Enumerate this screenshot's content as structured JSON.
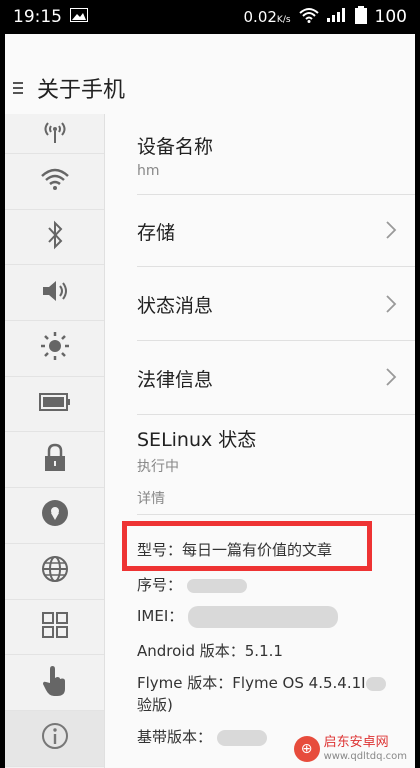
{
  "status_bar": {
    "time": "19:15",
    "network_speed": "0.02",
    "network_unit": "K/s",
    "battery": "100"
  },
  "header": {
    "title": "关于手机"
  },
  "sidebar": {
    "items": [
      {
        "icon": "antenna-icon"
      },
      {
        "icon": "wifi-icon"
      },
      {
        "icon": "bluetooth-icon"
      },
      {
        "icon": "volume-icon"
      },
      {
        "icon": "brightness-icon"
      },
      {
        "icon": "battery-icon"
      },
      {
        "icon": "lock-icon"
      },
      {
        "icon": "location-icon"
      },
      {
        "icon": "globe-icon"
      },
      {
        "icon": "apps-grid-icon"
      },
      {
        "icon": "hand-icon"
      },
      {
        "icon": "info-icon"
      }
    ]
  },
  "main": {
    "device_name_label": "设备名称",
    "device_name_value": "hm",
    "storage_label": "存储",
    "status_label": "状态消息",
    "legal_label": "法律信息",
    "selinux_label": "SELinux 状态",
    "selinux_value": "执行中",
    "details_header": "详情",
    "model_label": "型号：",
    "model_value": "每日一篇有价值的文章",
    "serial_label": "序号：",
    "imei_label": "IMEI：",
    "android_label": "Android 版本：",
    "android_value": "5.1.1",
    "flyme_label": "Flyme 版本：",
    "flyme_value": "Flyme OS 4.5.4.1I",
    "flyme_value_line2": "验版)",
    "baseband_label": "基带版本："
  },
  "watermark": {
    "name": "启东安卓网",
    "url": "www.qdltdq.com"
  }
}
